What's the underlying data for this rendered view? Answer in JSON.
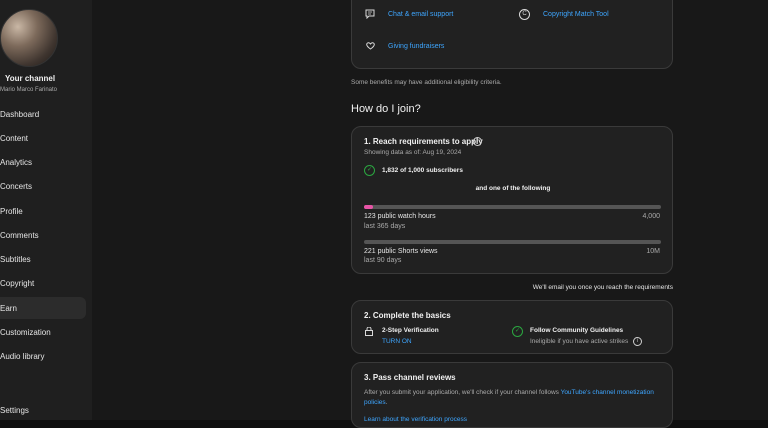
{
  "sidebar": {
    "channel_title": "Your channel",
    "channel_name": "Mario Marco Farinato",
    "items": [
      {
        "label": "Dashboard"
      },
      {
        "label": "Content"
      },
      {
        "label": "Analytics"
      },
      {
        "label": "Concerts"
      },
      {
        "label": "Profile"
      },
      {
        "label": "Comments"
      },
      {
        "label": "Subtitles"
      },
      {
        "label": "Copyright"
      },
      {
        "label": "Earn"
      },
      {
        "label": "Customization"
      },
      {
        "label": "Audio library"
      },
      {
        "label": "Settings"
      }
    ],
    "active_item": "Earn"
  },
  "benefits": {
    "items": [
      {
        "label": "Chat & email support",
        "icon": "chat-icon"
      },
      {
        "label": "Copyright Match Tool",
        "icon": "copyright-icon"
      },
      {
        "label": "Giving fundraisers",
        "icon": "heart-hands-icon"
      }
    ],
    "note": "Some benefits may have additional eligibility criteria."
  },
  "join": {
    "heading": "How do I join?",
    "step1": {
      "title": "1. Reach requirements to apply",
      "date_note": "Showing data as of: Aug 19, 2024",
      "subscribers": "1,832 of 1,000 subscribers",
      "or_text": "and one of the following",
      "watch_hours": {
        "label": "123 public watch hours",
        "target": "4,000",
        "period": "last 365 days",
        "progress": 0.03
      },
      "shorts_views": {
        "label": "221 public Shorts views",
        "target": "10M",
        "period": "last 90 days",
        "progress": 0.0
      }
    },
    "email_note": "We'll email you once you reach the requirements",
    "step2": {
      "title": "2. Complete the basics",
      "verification_title": "2-Step Verification",
      "verification_action": "TURN ON",
      "guidelines_title": "Follow Community Guidelines",
      "guidelines_note": "Ineligible if you have active strikes"
    },
    "step3": {
      "title": "3. Pass channel reviews",
      "desc_pre": "After you submit your application, we'll check if your channel follows ",
      "desc_link": "YouTube's channel monetization",
      "desc_link2": "policies",
      "desc_post": ".",
      "learn_more": "Learn about the verification process"
    }
  },
  "colors": {
    "accent_link": "#3ea6ff",
    "progress_fill": "#e754a6",
    "check": "#2ba640"
  }
}
